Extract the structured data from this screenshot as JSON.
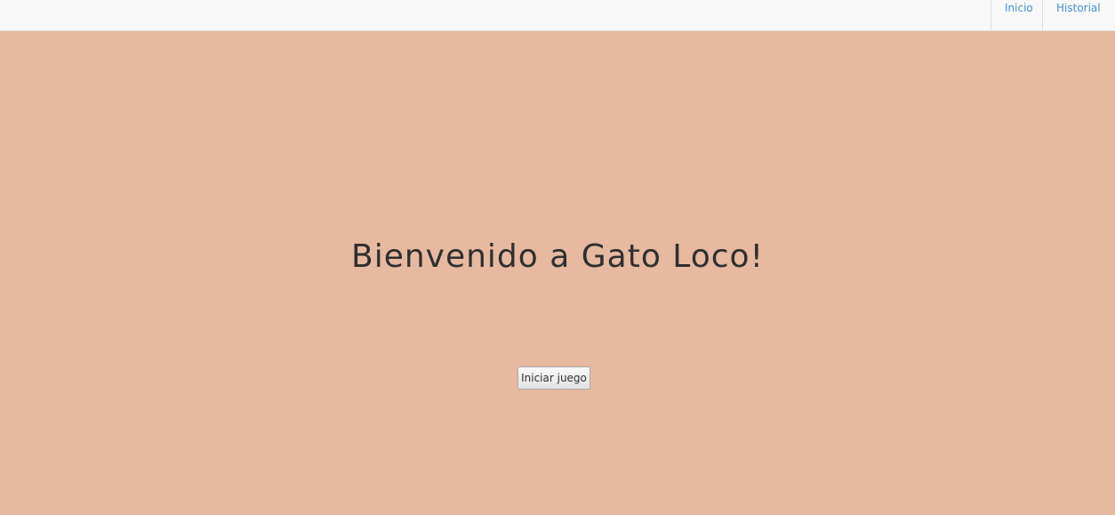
{
  "nav": {
    "items": [
      {
        "label": "Inicio"
      },
      {
        "label": "Historial"
      }
    ]
  },
  "main": {
    "title": "Bienvenido a Gato Loco!",
    "start_button": "Iniciar juego"
  },
  "colors": {
    "background": "#e6b9a0",
    "topbar": "#f8f8f8",
    "link": "#4a90d9",
    "title": "#2f2f2f"
  }
}
